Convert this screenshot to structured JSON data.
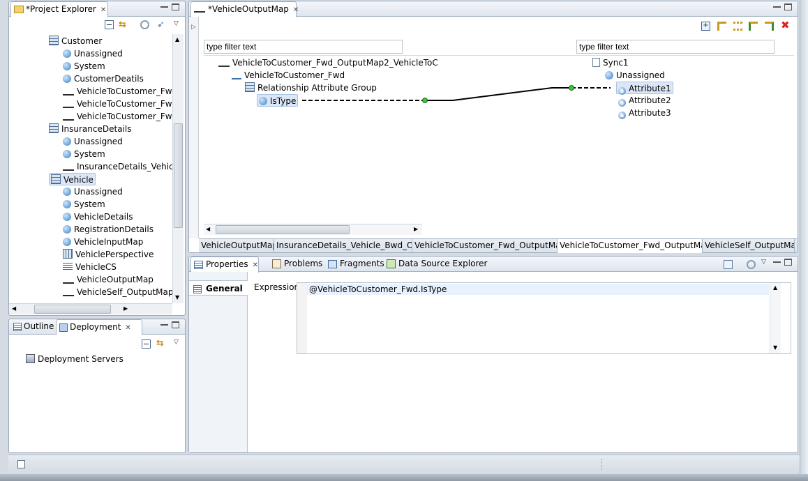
{
  "project_explorer": {
    "title": "*Project Explorer",
    "items": [
      {
        "label": "Customer",
        "icon": "table-icon",
        "indent": 1
      },
      {
        "label": "Unassigned",
        "icon": "ball-icon",
        "indent": 2
      },
      {
        "label": "System",
        "icon": "ball-icon",
        "indent": 2
      },
      {
        "label": "CustomerDeatils",
        "icon": "ball-icon",
        "indent": 2
      },
      {
        "label": "VehicleToCustomer_Fwd_",
        "icon": "map-icon",
        "indent": 2
      },
      {
        "label": "VehicleToCustomer_Fwd_",
        "icon": "map-icon",
        "indent": 2
      },
      {
        "label": "VehicleToCustomer_Fwd_",
        "icon": "map-icon",
        "indent": 2
      },
      {
        "label": "InsuranceDetails",
        "icon": "table-icon",
        "indent": 1
      },
      {
        "label": "Unassigned",
        "icon": "ball-icon",
        "indent": 2
      },
      {
        "label": "System",
        "icon": "ball-icon",
        "indent": 2
      },
      {
        "label": "InsuranceDetails_Vehicle_",
        "icon": "map-icon",
        "indent": 2
      },
      {
        "label": "Vehicle",
        "icon": "table-icon",
        "indent": 1
      },
      {
        "label": "Unassigned",
        "icon": "ball-icon",
        "indent": 2
      },
      {
        "label": "System",
        "icon": "ball-icon",
        "indent": 2
      },
      {
        "label": "VehicleDetails",
        "icon": "ball-icon",
        "indent": 2
      },
      {
        "label": "RegistrationDetails",
        "icon": "ball-icon",
        "indent": 2
      },
      {
        "label": "VehicleInputMap",
        "icon": "input-map-icon",
        "indent": 2
      },
      {
        "label": "VehiclePerspective",
        "icon": "grid-icon",
        "indent": 2
      },
      {
        "label": "VehicleCS",
        "icon": "lines-icon",
        "indent": 2
      },
      {
        "label": "VehicleOutputMap",
        "icon": "map-icon",
        "indent": 2
      },
      {
        "label": "VehicleSelf_OutputMap",
        "icon": "map-icon",
        "indent": 2
      }
    ]
  },
  "outline_panel": {
    "outline_tab": "Outline",
    "deployment_tab": "Deployment",
    "items": [
      {
        "label": "Deployment Servers"
      }
    ]
  },
  "editor": {
    "title": "*VehicleOutputMap",
    "left_filter": "type filter text",
    "right_filter": "type filter text",
    "left_tree": [
      {
        "label": "VehicleToCustomer_Fwd_OutputMap2_VehicleToC"
      },
      {
        "label": "VehicleToCustomer_Fwd"
      },
      {
        "label": "Relationship Attribute Group"
      },
      {
        "label": "IsType"
      }
    ],
    "right_tree": [
      {
        "label": "Sync1"
      },
      {
        "label": "Unassigned"
      },
      {
        "label": "Attribute1"
      },
      {
        "label": "Attribute2"
      },
      {
        "label": "Attribute3"
      }
    ],
    "bottom_tabs": [
      "VehicleOutputMap",
      "InsuranceDetails_Vehicle_Bwd_Ou...",
      "VehicleToCustomer_Fwd_OutputMa...",
      "VehicleToCustomer_Fwd_OutputMa...",
      "VehicleSelf_OutputMap"
    ]
  },
  "properties": {
    "tabs": [
      "Properties",
      "Problems",
      "Fragments",
      "Data Source Explorer"
    ],
    "section": "General",
    "expression_label": "Expression",
    "expression_value": "@VehicleToCustomer_Fwd.IsType"
  }
}
